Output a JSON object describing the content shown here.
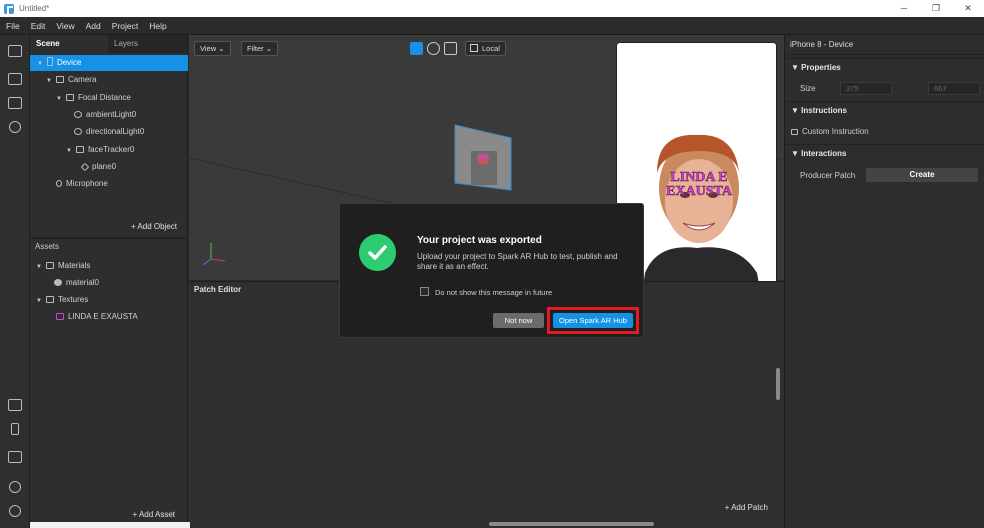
{
  "window": {
    "title": "Untitled*",
    "minimize": "─",
    "maximize": "❐",
    "close": "✕"
  },
  "menu": [
    "File",
    "Edit",
    "View",
    "Add",
    "Project",
    "Help"
  ],
  "scene": {
    "tabs": [
      "Scene",
      "Layers"
    ],
    "tree": [
      "Device",
      "Camera",
      "Focal Distance",
      "ambientLight0",
      "directionalLight0",
      "faceTracker0",
      "plane0",
      "Microphone"
    ],
    "add_object": "+ Add Object"
  },
  "assets": {
    "header": "Assets",
    "tree": [
      "Materials",
      "material0",
      "Textures",
      "LINDA E EXAUSTA"
    ],
    "add_asset": "+ Add Asset"
  },
  "viewport": {
    "view": "View ⌄",
    "filter": "Filter ⌄",
    "local": "Local"
  },
  "patch_editor": {
    "header": "Patch Editor",
    "add_patch": "+ Add Patch"
  },
  "preview_text": "LINDA E EXAUSTA",
  "inspector": {
    "title": "iPhone 8 - Device",
    "properties": "Properties",
    "size_label": "Size",
    "width": "375",
    "height": "667",
    "instructions": "Instructions",
    "custom_instruction": "Custom Instruction",
    "interactions": "Interactions",
    "producer_patch": "Producer Patch",
    "create": "Create"
  },
  "dialog": {
    "title": "Your project was exported",
    "body": "Upload your project to Spark AR Hub to test, publish and share it as an effect.",
    "checkbox_label": "Do not show this message in future",
    "not_now": "Not now",
    "open_hub": "Open Spark AR Hub"
  },
  "colors": {
    "accent": "#1591e6",
    "success": "#2ecc71",
    "highlight": "#e31b23"
  }
}
